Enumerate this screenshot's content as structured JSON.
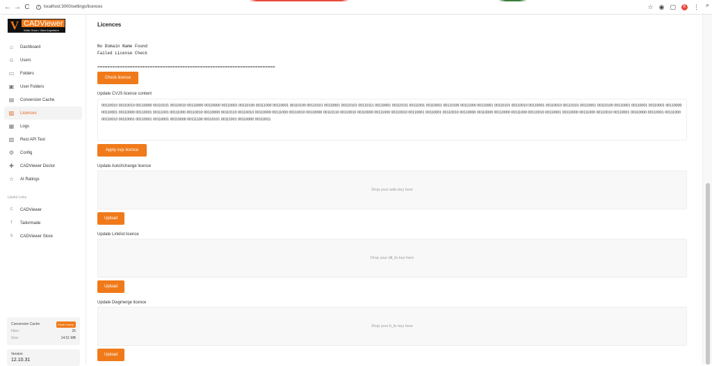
{
  "browser": {
    "url": "localhost:3000/settings/licences",
    "back": "←",
    "forward": "→",
    "reload": "C",
    "avatar_letter": "K"
  },
  "logo": {
    "v": "V",
    "name": "CADViewer",
    "tagline": "Write Once • View Anywhere"
  },
  "sidebar": {
    "items": [
      {
        "label": "Dashboard",
        "icon": "⌂"
      },
      {
        "label": "Users",
        "icon": "☺"
      },
      {
        "label": "Folders",
        "icon": "▭"
      },
      {
        "label": "User Folders",
        "icon": "▣"
      },
      {
        "label": "Conversion Cache",
        "icon": "▤"
      },
      {
        "label": "Licences",
        "icon": "▥"
      },
      {
        "label": "Logs",
        "icon": "▦"
      },
      {
        "label": "Rest API Test",
        "icon": "▧"
      },
      {
        "label": "Config",
        "icon": "⚙"
      },
      {
        "label": "CADViewer Doctor",
        "icon": "✚"
      },
      {
        "label": "AI Ratings",
        "icon": "☆"
      }
    ],
    "useful_links_title": "Useful Links",
    "links": [
      {
        "label": "CADViewer",
        "icon": "C"
      },
      {
        "label": "Tailormade",
        "icon": "T"
      },
      {
        "label": "CADViewer Store",
        "icon": "S"
      }
    ],
    "cache": {
      "title": "Conversion Cache",
      "flush": "Flush Cache",
      "files_label": "Files:",
      "files_value": "25",
      "size_label": "Size:",
      "size_value": "14.51 MB"
    },
    "version": {
      "label": "Version",
      "value": "12.10.31"
    }
  },
  "main": {
    "title": "Licences",
    "messages": [
      "No Domain Name Found",
      "Failed License Check"
    ],
    "separator": "=======================================================================",
    "check_button": "Check licence",
    "cvjs_label": "Update CVJS licence content",
    "cvjs_content": "00110010 00110010 00110000 00110101 00110010 00110000 00110000 00110001 00110100 00111000 00110001 00110100 00110101 00110001 00110101 00110111 00110001 00110101 00111001 00110001 00110100 00111000 00110001 00110101 00110010 00110001 00110010 00110101 00110001 00110100 00110001 00110001 00110001 00110000 00110001 00110000 00110001 00111001 00111000 00110010 00110000 00110110 00110010 00110000 00111000 00110010 00110000 00110110 00110010 00110000 00111000 00110010 00110001 00110001 00110010 00110000 00110000 00110000 00111000 00110010 00110001 00110000 00111000 00110010 00110001 00110000 00110001 00111000 00110010 00110001 00110001 00110001 00110000 00111100 00110101 00111001 00110000 00110011",
    "apply_button": "Apply cvjs licence",
    "autox_label": "Update AutoXchange licence",
    "autox_drop": "Drop your axlic.key here",
    "upload1": "Upload",
    "linklist_label": "Update Linklist licence",
    "linklist_drop": "Drop your dll_lic.key here",
    "upload2": "Upload",
    "dwgmerge_label": "Update Dwgmerge licence",
    "dwgmerge_drop": "Drop your lt_lic.key here",
    "upload3": "Upload"
  }
}
